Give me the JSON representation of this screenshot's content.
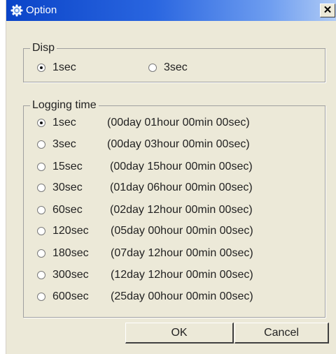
{
  "window": {
    "title": "Option",
    "close_glyph": "✕"
  },
  "disp": {
    "legend": "Disp",
    "options": [
      {
        "label": "1sec",
        "checked": true
      },
      {
        "label": "3sec",
        "checked": false
      }
    ]
  },
  "logging": {
    "legend": "Logging time",
    "options": [
      {
        "label": "1sec",
        "duration": "(00day 01hour 00min 00sec)",
        "checked": true
      },
      {
        "label": "3sec",
        "duration": "(00day 03hour 00min 00sec)",
        "checked": false
      },
      {
        "label": "15sec",
        "duration": "(00day 15hour 00min 00sec)",
        "checked": false
      },
      {
        "label": "30sec",
        "duration": "(01day 06hour 00min 00sec)",
        "checked": false
      },
      {
        "label": "60sec",
        "duration": "(02day 12hour 00min 00sec)",
        "checked": false
      },
      {
        "label": "120sec",
        "duration": "(05day 00hour 00min 00sec)",
        "checked": false
      },
      {
        "label": "180sec",
        "duration": "(07day 12hour 00min 00sec)",
        "checked": false
      },
      {
        "label": "300sec",
        "duration": "(12day 12hour 00min 00sec)",
        "checked": false
      },
      {
        "label": "600sec",
        "duration": "(25day 00hour 00min 00sec)",
        "checked": false
      }
    ]
  },
  "buttons": {
    "ok": "OK",
    "cancel": "Cancel"
  },
  "icons": {
    "app": "gear-icon",
    "close": "close-icon"
  },
  "colors": {
    "titlebar_start": "#0a44c8",
    "titlebar_end": "#b0cbf5",
    "dialog_bg": "#ece9d8"
  }
}
